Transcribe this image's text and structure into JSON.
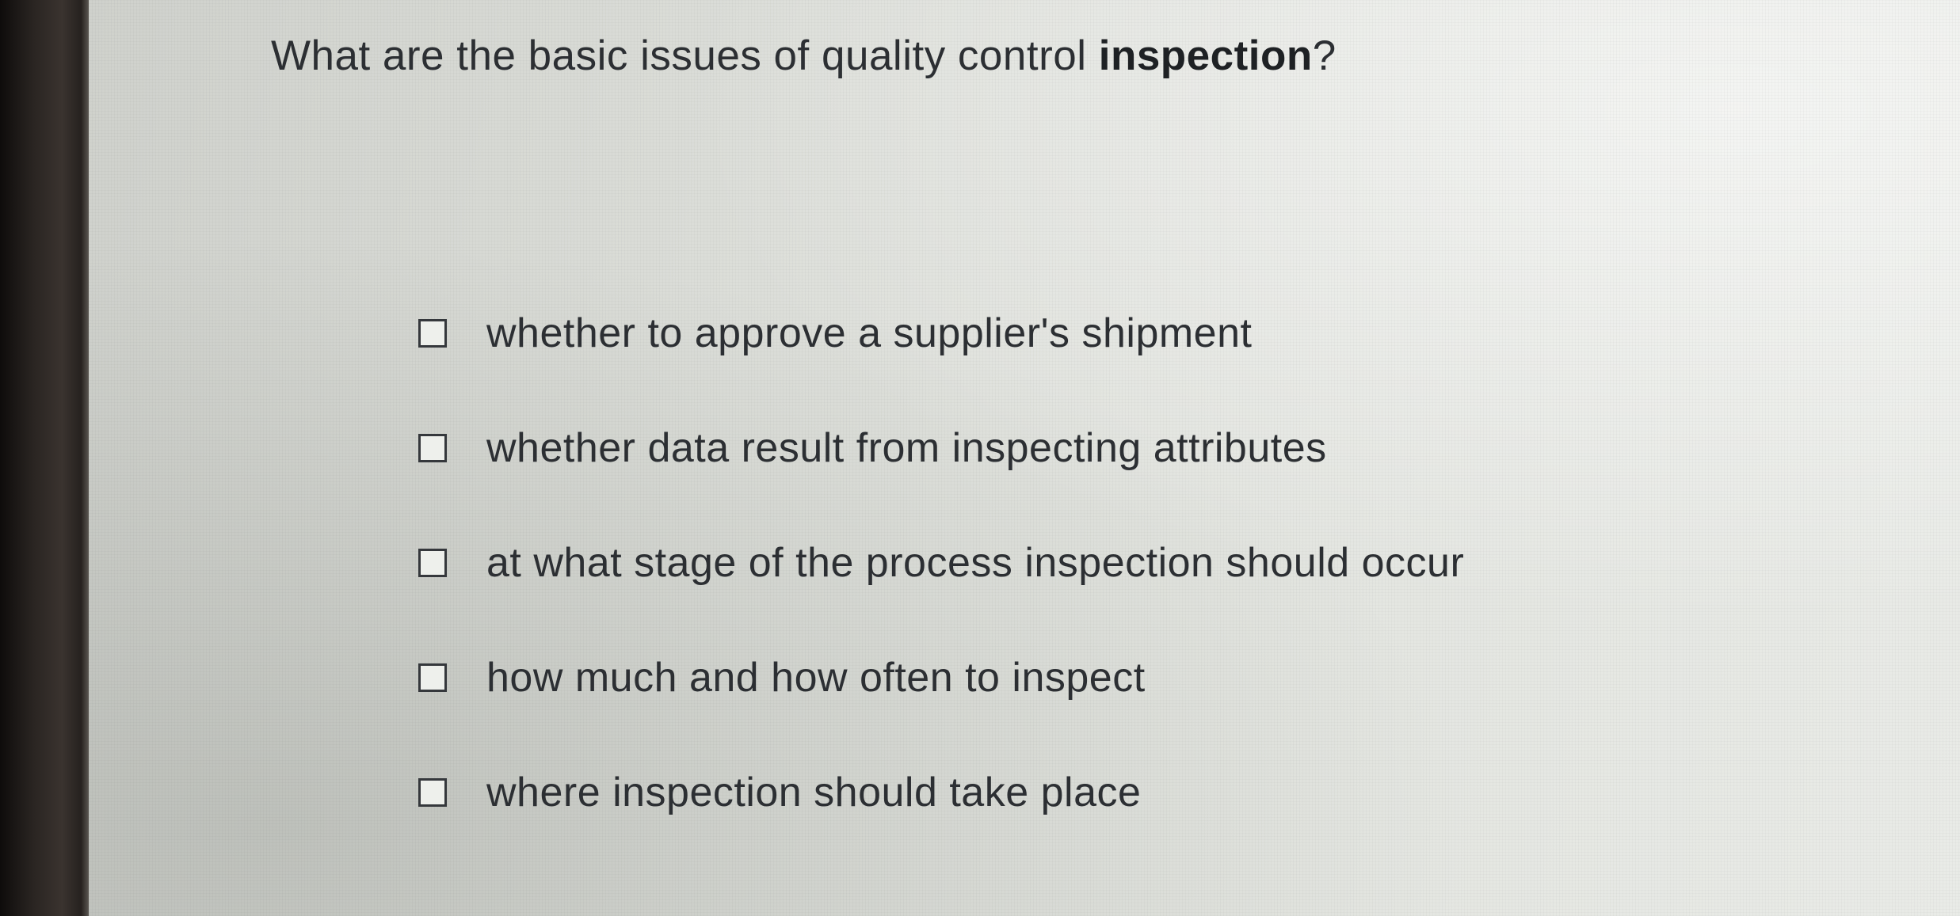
{
  "question": {
    "prefix": "What are the basic issues of quality control ",
    "emphasis": "inspection",
    "suffix": "?"
  },
  "options": [
    {
      "label": "whether to approve a supplier's shipment",
      "checked": false
    },
    {
      "label": "whether data result from inspecting attributes",
      "checked": false
    },
    {
      "label": "at what stage of the process inspection should occur",
      "checked": false
    },
    {
      "label": "how much and how often to inspect",
      "checked": false
    },
    {
      "label": "where inspection should take place",
      "checked": false
    }
  ]
}
